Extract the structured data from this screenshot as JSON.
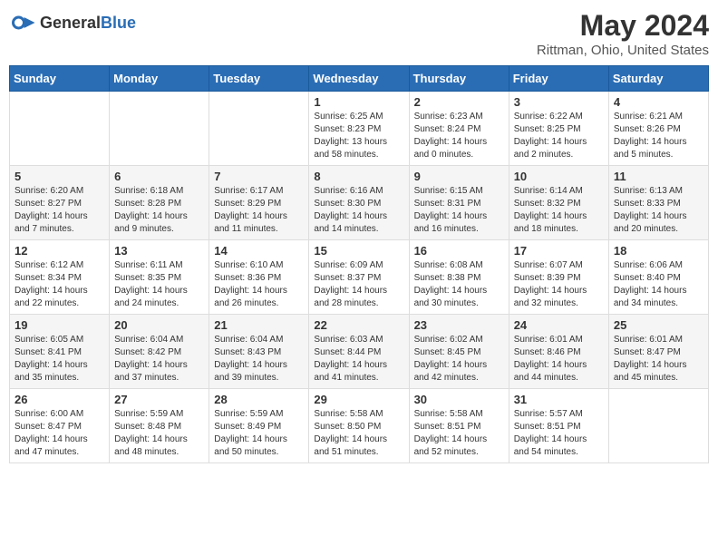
{
  "header": {
    "logo_general": "General",
    "logo_blue": "Blue",
    "title": "May 2024",
    "location": "Rittman, Ohio, United States"
  },
  "weekdays": [
    "Sunday",
    "Monday",
    "Tuesday",
    "Wednesday",
    "Thursday",
    "Friday",
    "Saturday"
  ],
  "weeks": [
    [
      {
        "day": "",
        "info": ""
      },
      {
        "day": "",
        "info": ""
      },
      {
        "day": "",
        "info": ""
      },
      {
        "day": "1",
        "info": "Sunrise: 6:25 AM\nSunset: 8:23 PM\nDaylight: 13 hours\nand 58 minutes."
      },
      {
        "day": "2",
        "info": "Sunrise: 6:23 AM\nSunset: 8:24 PM\nDaylight: 14 hours\nand 0 minutes."
      },
      {
        "day": "3",
        "info": "Sunrise: 6:22 AM\nSunset: 8:25 PM\nDaylight: 14 hours\nand 2 minutes."
      },
      {
        "day": "4",
        "info": "Sunrise: 6:21 AM\nSunset: 8:26 PM\nDaylight: 14 hours\nand 5 minutes."
      }
    ],
    [
      {
        "day": "5",
        "info": "Sunrise: 6:20 AM\nSunset: 8:27 PM\nDaylight: 14 hours\nand 7 minutes."
      },
      {
        "day": "6",
        "info": "Sunrise: 6:18 AM\nSunset: 8:28 PM\nDaylight: 14 hours\nand 9 minutes."
      },
      {
        "day": "7",
        "info": "Sunrise: 6:17 AM\nSunset: 8:29 PM\nDaylight: 14 hours\nand 11 minutes."
      },
      {
        "day": "8",
        "info": "Sunrise: 6:16 AM\nSunset: 8:30 PM\nDaylight: 14 hours\nand 14 minutes."
      },
      {
        "day": "9",
        "info": "Sunrise: 6:15 AM\nSunset: 8:31 PM\nDaylight: 14 hours\nand 16 minutes."
      },
      {
        "day": "10",
        "info": "Sunrise: 6:14 AM\nSunset: 8:32 PM\nDaylight: 14 hours\nand 18 minutes."
      },
      {
        "day": "11",
        "info": "Sunrise: 6:13 AM\nSunset: 8:33 PM\nDaylight: 14 hours\nand 20 minutes."
      }
    ],
    [
      {
        "day": "12",
        "info": "Sunrise: 6:12 AM\nSunset: 8:34 PM\nDaylight: 14 hours\nand 22 minutes."
      },
      {
        "day": "13",
        "info": "Sunrise: 6:11 AM\nSunset: 8:35 PM\nDaylight: 14 hours\nand 24 minutes."
      },
      {
        "day": "14",
        "info": "Sunrise: 6:10 AM\nSunset: 8:36 PM\nDaylight: 14 hours\nand 26 minutes."
      },
      {
        "day": "15",
        "info": "Sunrise: 6:09 AM\nSunset: 8:37 PM\nDaylight: 14 hours\nand 28 minutes."
      },
      {
        "day": "16",
        "info": "Sunrise: 6:08 AM\nSunset: 8:38 PM\nDaylight: 14 hours\nand 30 minutes."
      },
      {
        "day": "17",
        "info": "Sunrise: 6:07 AM\nSunset: 8:39 PM\nDaylight: 14 hours\nand 32 minutes."
      },
      {
        "day": "18",
        "info": "Sunrise: 6:06 AM\nSunset: 8:40 PM\nDaylight: 14 hours\nand 34 minutes."
      }
    ],
    [
      {
        "day": "19",
        "info": "Sunrise: 6:05 AM\nSunset: 8:41 PM\nDaylight: 14 hours\nand 35 minutes."
      },
      {
        "day": "20",
        "info": "Sunrise: 6:04 AM\nSunset: 8:42 PM\nDaylight: 14 hours\nand 37 minutes."
      },
      {
        "day": "21",
        "info": "Sunrise: 6:04 AM\nSunset: 8:43 PM\nDaylight: 14 hours\nand 39 minutes."
      },
      {
        "day": "22",
        "info": "Sunrise: 6:03 AM\nSunset: 8:44 PM\nDaylight: 14 hours\nand 41 minutes."
      },
      {
        "day": "23",
        "info": "Sunrise: 6:02 AM\nSunset: 8:45 PM\nDaylight: 14 hours\nand 42 minutes."
      },
      {
        "day": "24",
        "info": "Sunrise: 6:01 AM\nSunset: 8:46 PM\nDaylight: 14 hours\nand 44 minutes."
      },
      {
        "day": "25",
        "info": "Sunrise: 6:01 AM\nSunset: 8:47 PM\nDaylight: 14 hours\nand 45 minutes."
      }
    ],
    [
      {
        "day": "26",
        "info": "Sunrise: 6:00 AM\nSunset: 8:47 PM\nDaylight: 14 hours\nand 47 minutes."
      },
      {
        "day": "27",
        "info": "Sunrise: 5:59 AM\nSunset: 8:48 PM\nDaylight: 14 hours\nand 48 minutes."
      },
      {
        "day": "28",
        "info": "Sunrise: 5:59 AM\nSunset: 8:49 PM\nDaylight: 14 hours\nand 50 minutes."
      },
      {
        "day": "29",
        "info": "Sunrise: 5:58 AM\nSunset: 8:50 PM\nDaylight: 14 hours\nand 51 minutes."
      },
      {
        "day": "30",
        "info": "Sunrise: 5:58 AM\nSunset: 8:51 PM\nDaylight: 14 hours\nand 52 minutes."
      },
      {
        "day": "31",
        "info": "Sunrise: 5:57 AM\nSunset: 8:51 PM\nDaylight: 14 hours\nand 54 minutes."
      },
      {
        "day": "",
        "info": ""
      }
    ]
  ]
}
